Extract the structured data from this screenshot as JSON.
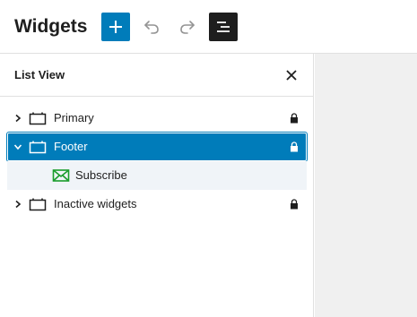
{
  "header": {
    "title": "Widgets"
  },
  "list_view": {
    "title": "List View",
    "items": [
      {
        "label": "Primary"
      },
      {
        "label": "Footer"
      },
      {
        "label": "Subscribe"
      },
      {
        "label": "Inactive widgets"
      }
    ]
  },
  "colors": {
    "accent": "#007cba",
    "dark": "#1e1e1e",
    "canvas": "#f0f0f0",
    "subscribe_icon": "#1a9d2c"
  },
  "icons": {
    "add": "plus-icon",
    "undo": "undo-icon",
    "redo": "redo-icon",
    "list_view": "list-view-icon",
    "close": "close-icon",
    "chevron_right": "chevron-right-icon",
    "chevron_down": "chevron-down-icon",
    "widget_area": "widget-area-icon",
    "subscribe": "envelope-icon",
    "lock": "lock-icon"
  }
}
